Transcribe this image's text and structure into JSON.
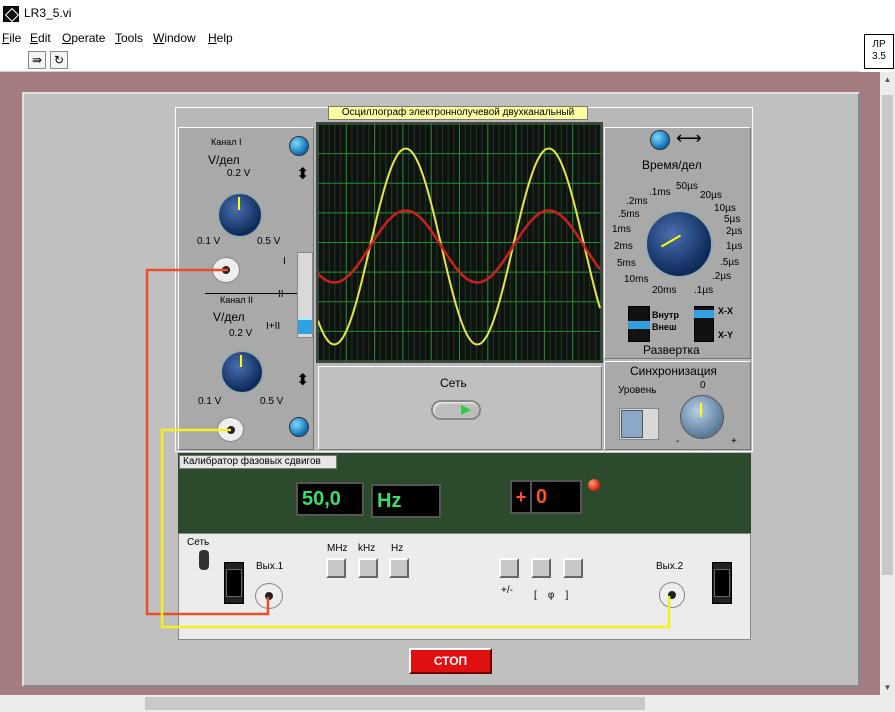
{
  "window": {
    "title": "LR3_5.vi",
    "badge": "ЛР 3.5"
  },
  "menu": [
    "File",
    "Edit",
    "Operate",
    "Tools",
    "Window",
    "Help"
  ],
  "oscilloscope": {
    "title": "Осциллограф электроннолучевой двухканальный",
    "channel1": {
      "label": "Канал I",
      "unit": "V/дел",
      "v_mid": "0.2 V",
      "v_left": "0.1 V",
      "v_right": "0.5 V"
    },
    "channel2": {
      "label": "Канал II",
      "unit": "V/дел",
      "v_mid": "0.2 V",
      "v_left": "0.1 V",
      "v_right": "0.5 V"
    },
    "mode_switch": [
      "I",
      "II",
      "I+II"
    ],
    "network_label": "Сеть",
    "time_per_div": {
      "label": "Время/дел",
      "ticks": [
        ".2ms",
        ".1ms",
        "50µs",
        "20µs",
        "10µs",
        "5µs",
        "2µs",
        "1µs",
        ".5µs",
        ".2µs",
        ".1µs",
        "20ms",
        "10ms",
        "5ms",
        "2ms",
        "1ms",
        ".5ms"
      ]
    },
    "sweep": {
      "label": "Развертка",
      "internal": "Внутр",
      "external": "Внеш",
      "xx": "X-X",
      "xy": "X-Y"
    },
    "sync": {
      "label": "Синхронизация",
      "level": "Уровень",
      "zero": "0",
      "minus": "-",
      "plus": "+"
    }
  },
  "generator": {
    "title": "Калибратор фазовых сдвигов",
    "frequency": "50,0",
    "unit": "Hz",
    "phase_sign": "+",
    "phase": "0",
    "power_label": "Сеть",
    "out1": "Вых.1",
    "out2": "Вых.2",
    "units": [
      "MHz",
      "kHz",
      "Hz"
    ],
    "sign_label": "+/-",
    "phi_label": "[    φ    ]"
  },
  "stop_label": "СТОП",
  "colors": {
    "background": "#a47b7e",
    "panel": "#c0c0c0",
    "ch1_trace": "#e6e64a",
    "ch2_trace": "#cc2020",
    "wire_red": "#e8502a",
    "wire_yellow": "#f5f020"
  }
}
